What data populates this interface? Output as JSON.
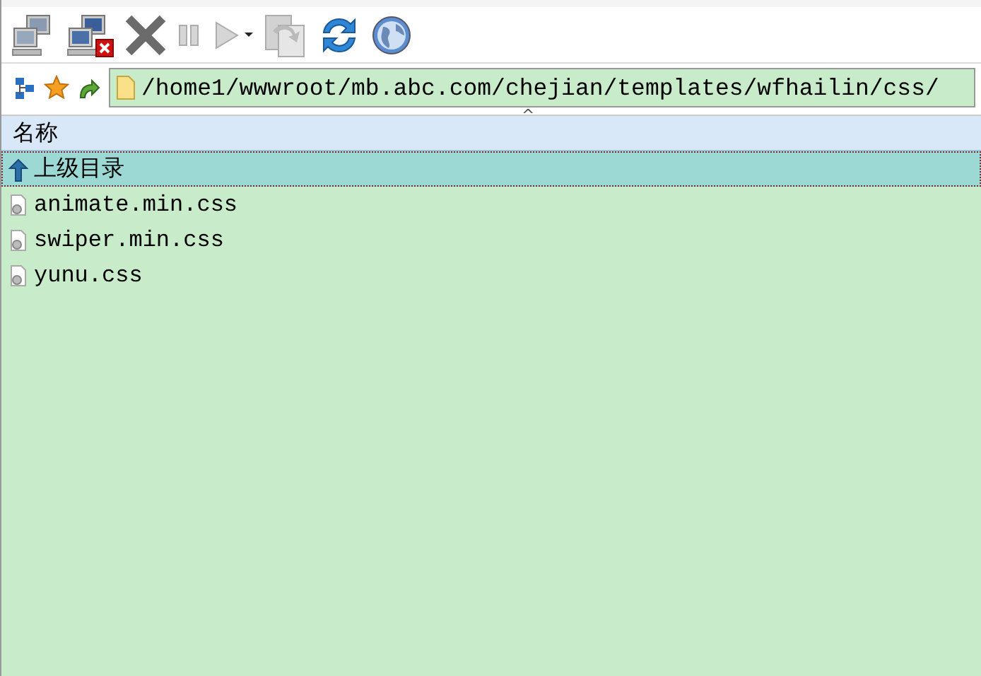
{
  "toolbar": [
    {
      "kind": "connect",
      "disabled": false
    },
    {
      "kind": "disconnect",
      "disabled": false
    },
    {
      "kind": "stop",
      "disabled": false
    },
    {
      "kind": "pause",
      "disabled": true
    },
    {
      "kind": "play",
      "disabled": true
    },
    {
      "kind": "dropdown",
      "disabled": false
    },
    {
      "kind": "transfer",
      "disabled": true
    },
    {
      "kind": "refresh",
      "disabled": false
    },
    {
      "kind": "web",
      "disabled": false
    }
  ],
  "address_bar": {
    "path": "/home1/wwwroot/mb.abc.com/chejian/templates/wfhailin/css/"
  },
  "file_list": {
    "columns": [
      {
        "label": "名称",
        "sort_indicator": "^"
      }
    ],
    "rows": [
      {
        "kind": "parent",
        "name": "上级目录",
        "selected": true
      },
      {
        "kind": "file",
        "name": "animate.min.css",
        "selected": false
      },
      {
        "kind": "file",
        "name": "swiper.min.css",
        "selected": false
      },
      {
        "kind": "file",
        "name": "yunu.css",
        "selected": false
      }
    ]
  }
}
